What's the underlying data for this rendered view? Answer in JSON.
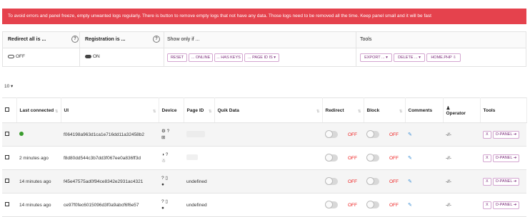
{
  "alert": "To avoid errors and panel freeze, empty unwanted logs regularly. There is button to remove empty logs that not have any data. Those logs need to be removed all the time. Keep panel small and it will be fast",
  "controls": {
    "redirect_all": {
      "label": "Redirect all is ...",
      "state": "OFF"
    },
    "registration": {
      "label": "Registration is ...",
      "state": "ON"
    },
    "show_only": {
      "label": "Show only if ...",
      "buttons": [
        "RESET",
        "... ONLINE",
        "... HAS KEYS",
        "... PAGE ID IS ▾"
      ]
    },
    "tools": {
      "label": "Tools",
      "buttons": [
        "EXPORT ... ▾",
        "DELETE ... ▾",
        "HOME.PHP ⇩"
      ]
    }
  },
  "page_length": "10 ▾",
  "table": {
    "headers": [
      "",
      "Last connected",
      "UI",
      "Device",
      "Page ID",
      "Quik Data",
      "Redirect",
      "Block",
      "Comments",
      "Operator",
      "Tools"
    ],
    "rows": [
      {
        "last": "",
        "online": true,
        "ui": "f064198a963d1ca1e716dd11a32458b2",
        "device": [
          "⚙ ?",
          "⊞"
        ],
        "page_id": "",
        "redirect": "OFF",
        "block": "OFF",
        "operator": "-//-"
      },
      {
        "last": "2 minutes ago",
        "online": false,
        "ui": "f8d80dd544c3b7dd3f067ee0a836ff3d",
        "device": [
          "◑ ?",
          "☃"
        ],
        "page_id": "",
        "redirect": "OFF",
        "block": "OFF",
        "operator": "-//-"
      },
      {
        "last": "14 minutes ago",
        "online": false,
        "ui": "f45e47575ad0f94ce8342e2931ac4321",
        "device": [
          "? ▯",
          "●"
        ],
        "page_id": "undefined",
        "redirect": "OFF",
        "block": "OFF",
        "operator": "-//-"
      },
      {
        "last": "14 minutes ago",
        "online": false,
        "ui": "ce97f0fec6015096d3f0a9abcf6f6e57",
        "device": [
          "? ▯",
          "●"
        ],
        "page_id": "undefined",
        "redirect": "OFF",
        "block": "OFF",
        "operator": "-//-"
      }
    ],
    "tool_buttons": [
      "X",
      "O-PANEL ➔"
    ]
  },
  "colors": {
    "alert": "#e5424d",
    "accent": "#7b2b7a",
    "status_off": "#e22",
    "online": "#3a9c2e"
  }
}
